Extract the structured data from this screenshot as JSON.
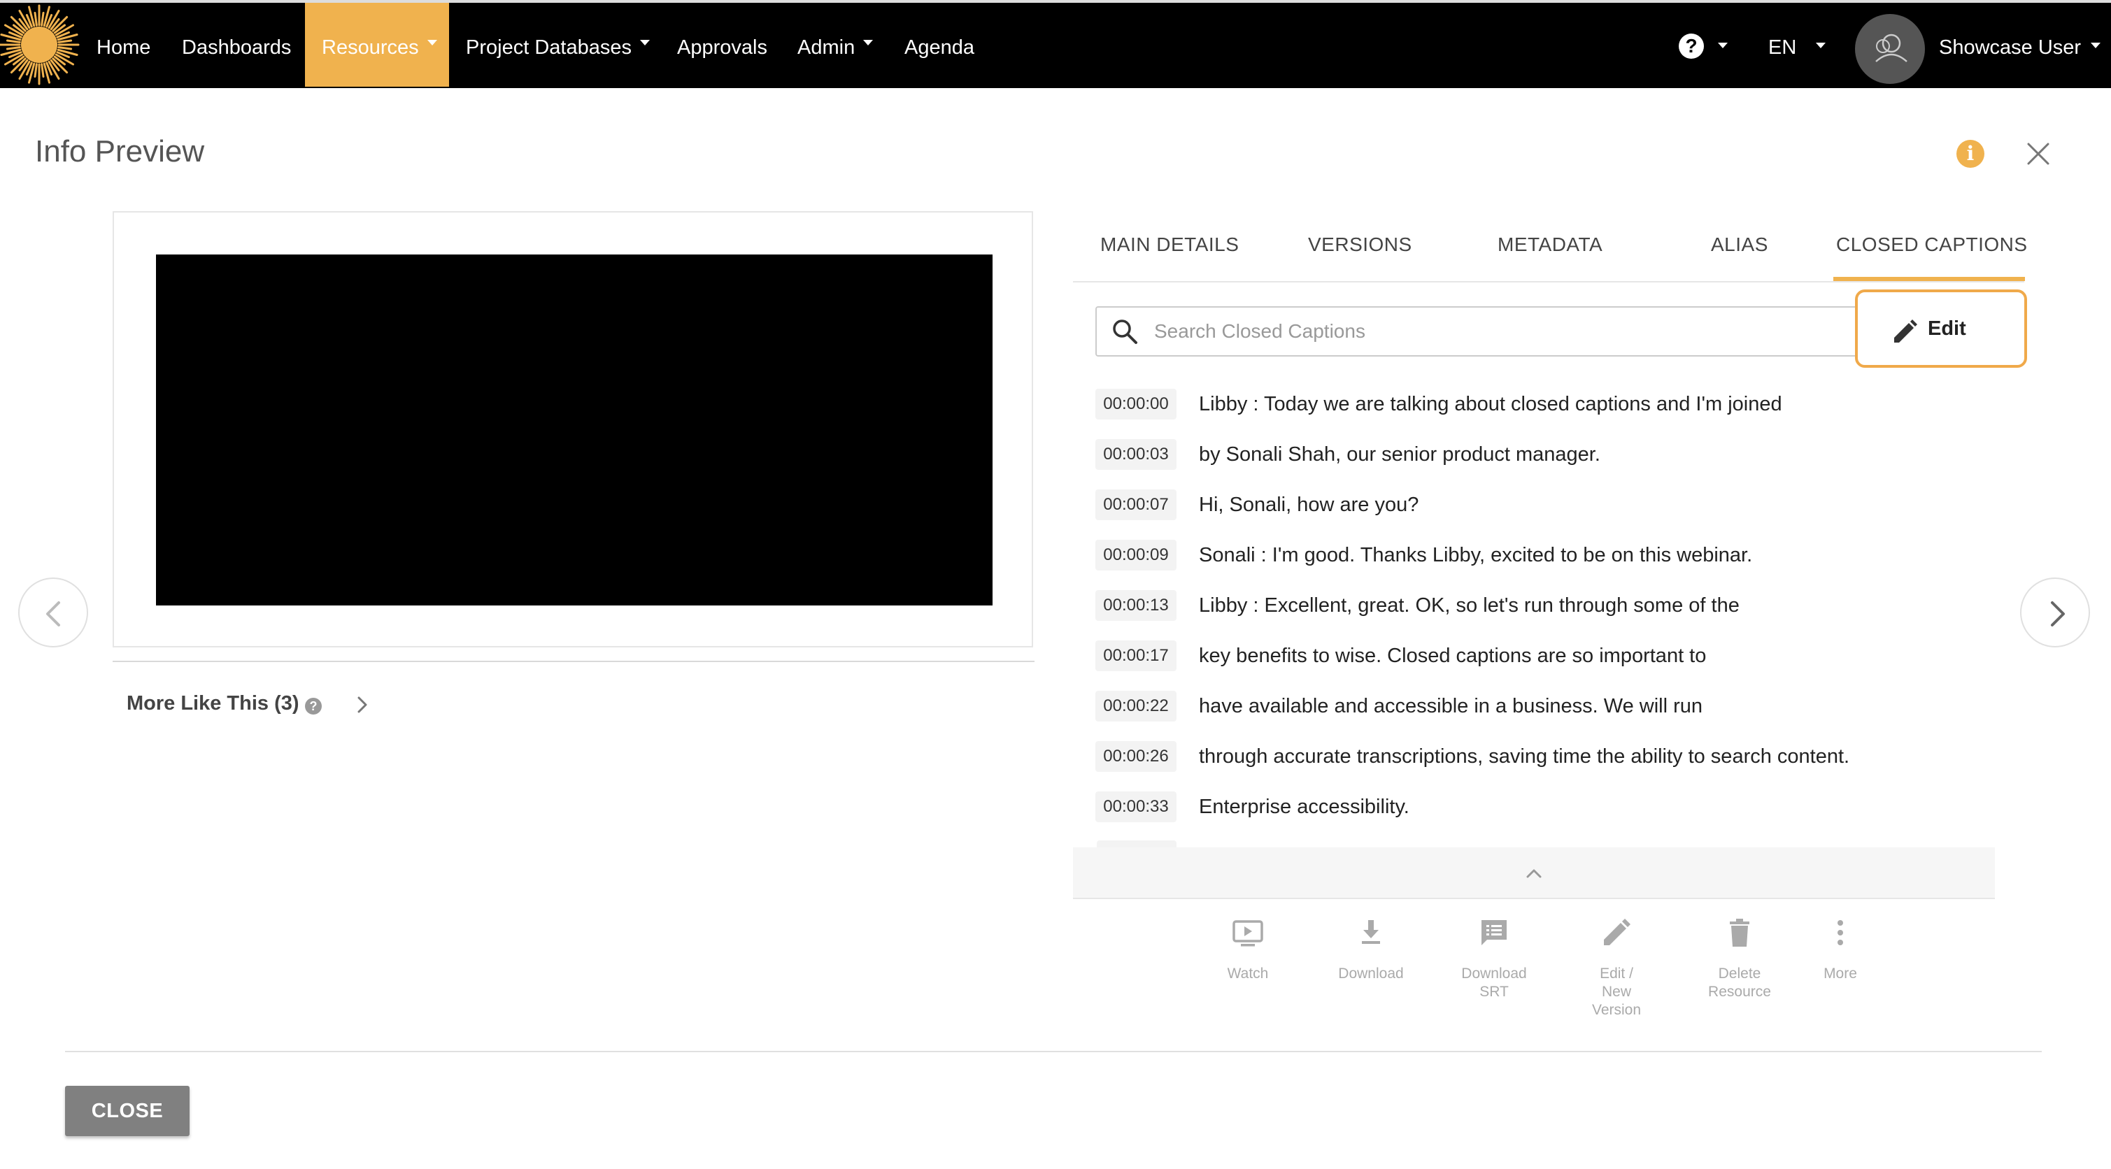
{
  "nav": {
    "items": [
      {
        "label": "Home",
        "caret": false
      },
      {
        "label": "Dashboards",
        "caret": false
      },
      {
        "label": "Resources",
        "caret": true,
        "active": true
      },
      {
        "label": "Project Databases",
        "caret": true
      },
      {
        "label": "Approvals",
        "caret": false
      },
      {
        "label": "Admin",
        "caret": true
      },
      {
        "label": "Agenda",
        "caret": false
      }
    ],
    "help_glyph": "?",
    "language": "EN",
    "user_name": "Showcase User",
    "accent_color": "#f0b24e"
  },
  "header": {
    "title": "Info Preview",
    "info_glyph": "i"
  },
  "preview": {
    "more_like_this": "More Like This (3)",
    "help_glyph": "?"
  },
  "tabs": [
    {
      "label": "MAIN DETAILS",
      "active": false
    },
    {
      "label": "VERSIONS",
      "active": false
    },
    {
      "label": "METADATA",
      "active": false
    },
    {
      "label": "ALIAS",
      "active": false
    },
    {
      "label": "CLOSED CAPTIONS",
      "active": true
    }
  ],
  "captions": {
    "search_placeholder": "Search Closed Captions",
    "edit_label": "Edit",
    "rows": [
      {
        "time": "00:00:00",
        "text": "Libby : Today we are talking about closed captions and I'm joined"
      },
      {
        "time": "00:00:03",
        "text": "by Sonali Shah, our senior product manager."
      },
      {
        "time": "00:00:07",
        "text": "Hi, Sonali, how are you?"
      },
      {
        "time": "00:00:09",
        "text": "Sonali : I'm good. Thanks Libby, excited to be on this webinar."
      },
      {
        "time": "00:00:13",
        "text": "Libby : Excellent, great. OK, so let's run through some of the"
      },
      {
        "time": "00:00:17",
        "text": "key benefits to wise. Closed captions are so important to"
      },
      {
        "time": "00:00:22",
        "text": "have available and accessible in a business. We will run"
      },
      {
        "time": "00:00:26",
        "text": "through accurate transcriptions, saving time the ability to search content."
      },
      {
        "time": "00:00:33",
        "text": "Enterprise accessibility."
      }
    ]
  },
  "actions": [
    {
      "label_lines": [
        "Watch"
      ],
      "icon": "watch-icon"
    },
    {
      "label_lines": [
        "Download"
      ],
      "icon": "download-icon"
    },
    {
      "label_lines": [
        "Download",
        "SRT"
      ],
      "icon": "download-srt-icon"
    },
    {
      "label_lines": [
        "Edit /",
        "New",
        "Version"
      ],
      "icon": "edit-version-icon"
    },
    {
      "label_lines": [
        "Delete",
        "Resource"
      ],
      "icon": "delete-icon"
    },
    {
      "label_lines": [
        "More"
      ],
      "icon": "more-vertical-icon"
    }
  ],
  "footer": {
    "close_label": "CLOSE"
  }
}
